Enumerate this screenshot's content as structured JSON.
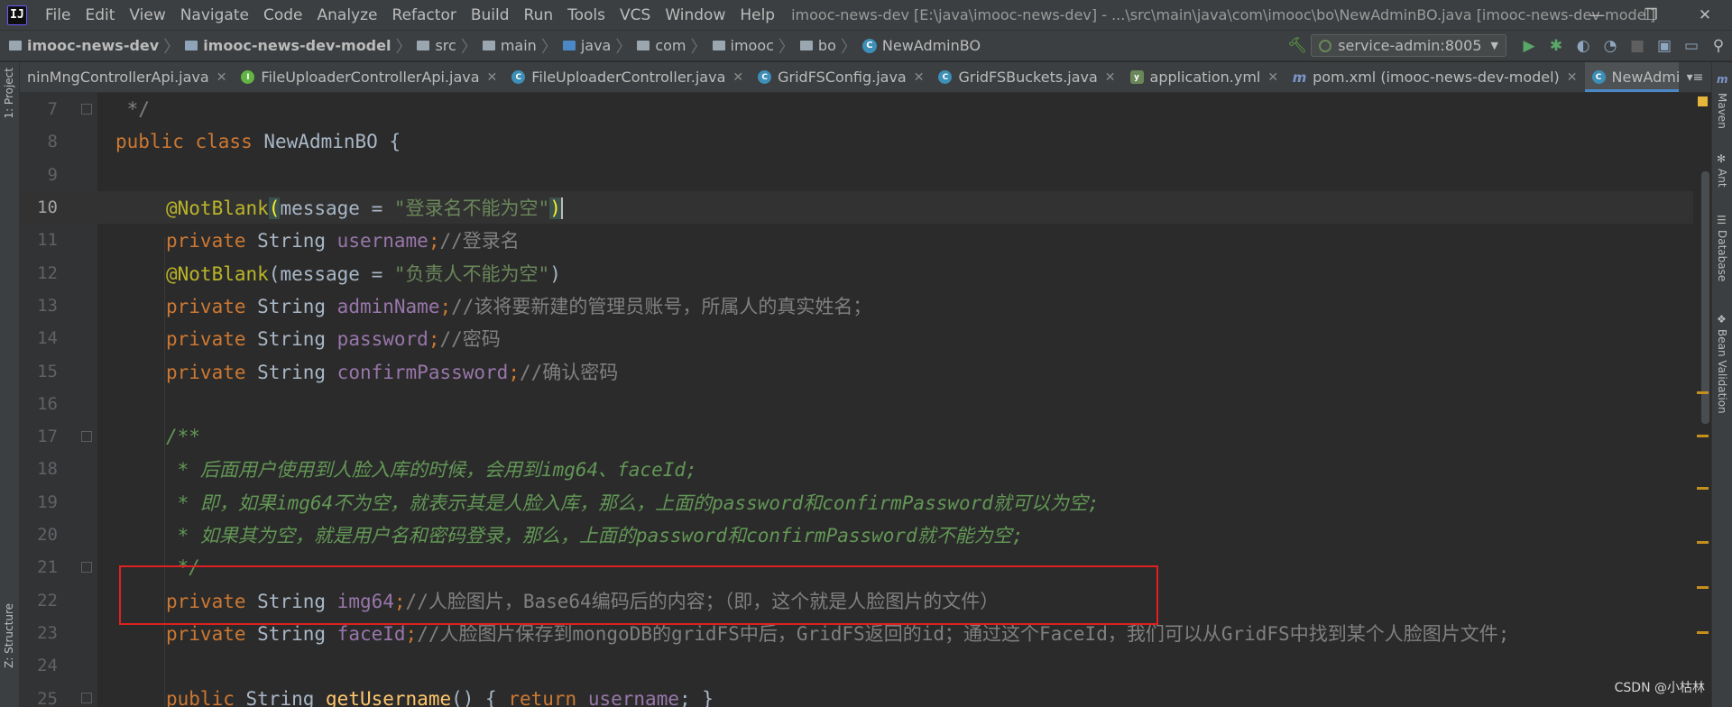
{
  "menubar": {
    "logo": "IJ",
    "items": [
      "File",
      "Edit",
      "View",
      "Navigate",
      "Code",
      "Analyze",
      "Refactor",
      "Build",
      "Run",
      "Tools",
      "VCS",
      "Window",
      "Help"
    ],
    "title": "imooc-news-dev [E:\\java\\imooc-news-dev] - ...\\src\\main\\java\\com\\imooc\\bo\\NewAdminBO.java [imooc-news-dev-model]",
    "window_controls": [
      "—",
      "❐",
      "✕"
    ]
  },
  "navbar": {
    "crumbs": [
      "imooc-news-dev",
      "imooc-news-dev-model",
      "src",
      "main",
      "java",
      "com",
      "imooc",
      "bo",
      "NewAdminBO"
    ],
    "run_config": "service-admin:8005"
  },
  "tabs": [
    {
      "label": "ninMngControllerApi.java",
      "icon": "interface-icon"
    },
    {
      "label": "FileUploaderControllerApi.java",
      "icon": "interface-icon"
    },
    {
      "label": "FileUploaderController.java",
      "icon": "class-icon"
    },
    {
      "label": "GridFSConfig.java",
      "icon": "class-icon"
    },
    {
      "label": "GridFSBuckets.java",
      "icon": "class-icon"
    },
    {
      "label": "application.yml",
      "icon": "yaml-icon"
    },
    {
      "label": "pom.xml (imooc-news-dev-model)",
      "icon": "maven-icon"
    },
    {
      "label": "NewAdminBO.java",
      "icon": "class-icon",
      "active": true
    }
  ],
  "left_tools": {
    "project": "1: Project",
    "structure": "Z: Structure"
  },
  "right_tools": [
    "Maven",
    "Ant",
    "Database",
    "Bean Validation"
  ],
  "code_lines": [
    {
      "num": "7"
    },
    {
      "num": "8"
    },
    {
      "num": "9"
    },
    {
      "num": "10"
    },
    {
      "num": "11"
    },
    {
      "num": "12"
    },
    {
      "num": "13"
    },
    {
      "num": "14"
    },
    {
      "num": "15"
    },
    {
      "num": "16"
    },
    {
      "num": "17"
    },
    {
      "num": "18"
    },
    {
      "num": "19"
    },
    {
      "num": "20"
    },
    {
      "num": "21"
    },
    {
      "num": "22"
    },
    {
      "num": "23"
    },
    {
      "num": "24"
    },
    {
      "num": "25"
    }
  ],
  "tokens": {
    "l7": " */",
    "l8_kw": "public class ",
    "l8_name": "NewAdminBO {",
    "ann": "@NotBlank",
    "paren_open": "(",
    "message_eq": "message = ",
    "paren_close": ")",
    "l10_str": "\"登录名不能为空\"",
    "priv": "private ",
    "string": "String ",
    "semi": ";",
    "l11_fld": "username",
    "l11_cmt": "//登录名",
    "l12_str": "\"负责人不能为空\"",
    "l13_fld": "adminName",
    "l13_cmt": "//该将要新建的管理员账号，所属人的真实姓名；",
    "l14_fld": "password",
    "l14_cmt": "//密码",
    "l15_fld": "confirmPassword",
    "l15_cmt": "//确认密码",
    "l17": "/**",
    "l18": " * 后面用户使用到人脸入库的时候，会用到img64、faceId;",
    "l19": " * 即，如果img64不为空，就表示其是人脸入库，那么，上面的password和confirmPassword就可以为空;",
    "l20": " * 如果其为空，就是用户名和密码登录，那么，上面的password和confirmPassword就不能为空;",
    "l21": " */",
    "l22_fld": "img64",
    "l22_cmt": "//人脸图片，Base64编码后的内容；（即，这个就是人脸图片的文件）",
    "l23_fld": "faceId",
    "l23_cmt": "//人脸图片保存到mongoDB的gridFS中后，GridFS返回的id；通过这个FaceId，我们可以从GridFS中找到某个人脸图片文件;",
    "l25_kw": "public ",
    "l25_type": "String ",
    "l25_method": "getUsername",
    "l25_rest": "() { ",
    "l25_ret": "return ",
    "l25_fld": "username",
    "l25_end": "; }"
  },
  "watermark": "CSDN @小枯林",
  "colors": {
    "keyword": "#cc7832",
    "field": "#9876aa",
    "annotation": "#bbb529",
    "string": "#6a8759",
    "doc_comment": "#629755",
    "highlight_box": "#e02020"
  }
}
